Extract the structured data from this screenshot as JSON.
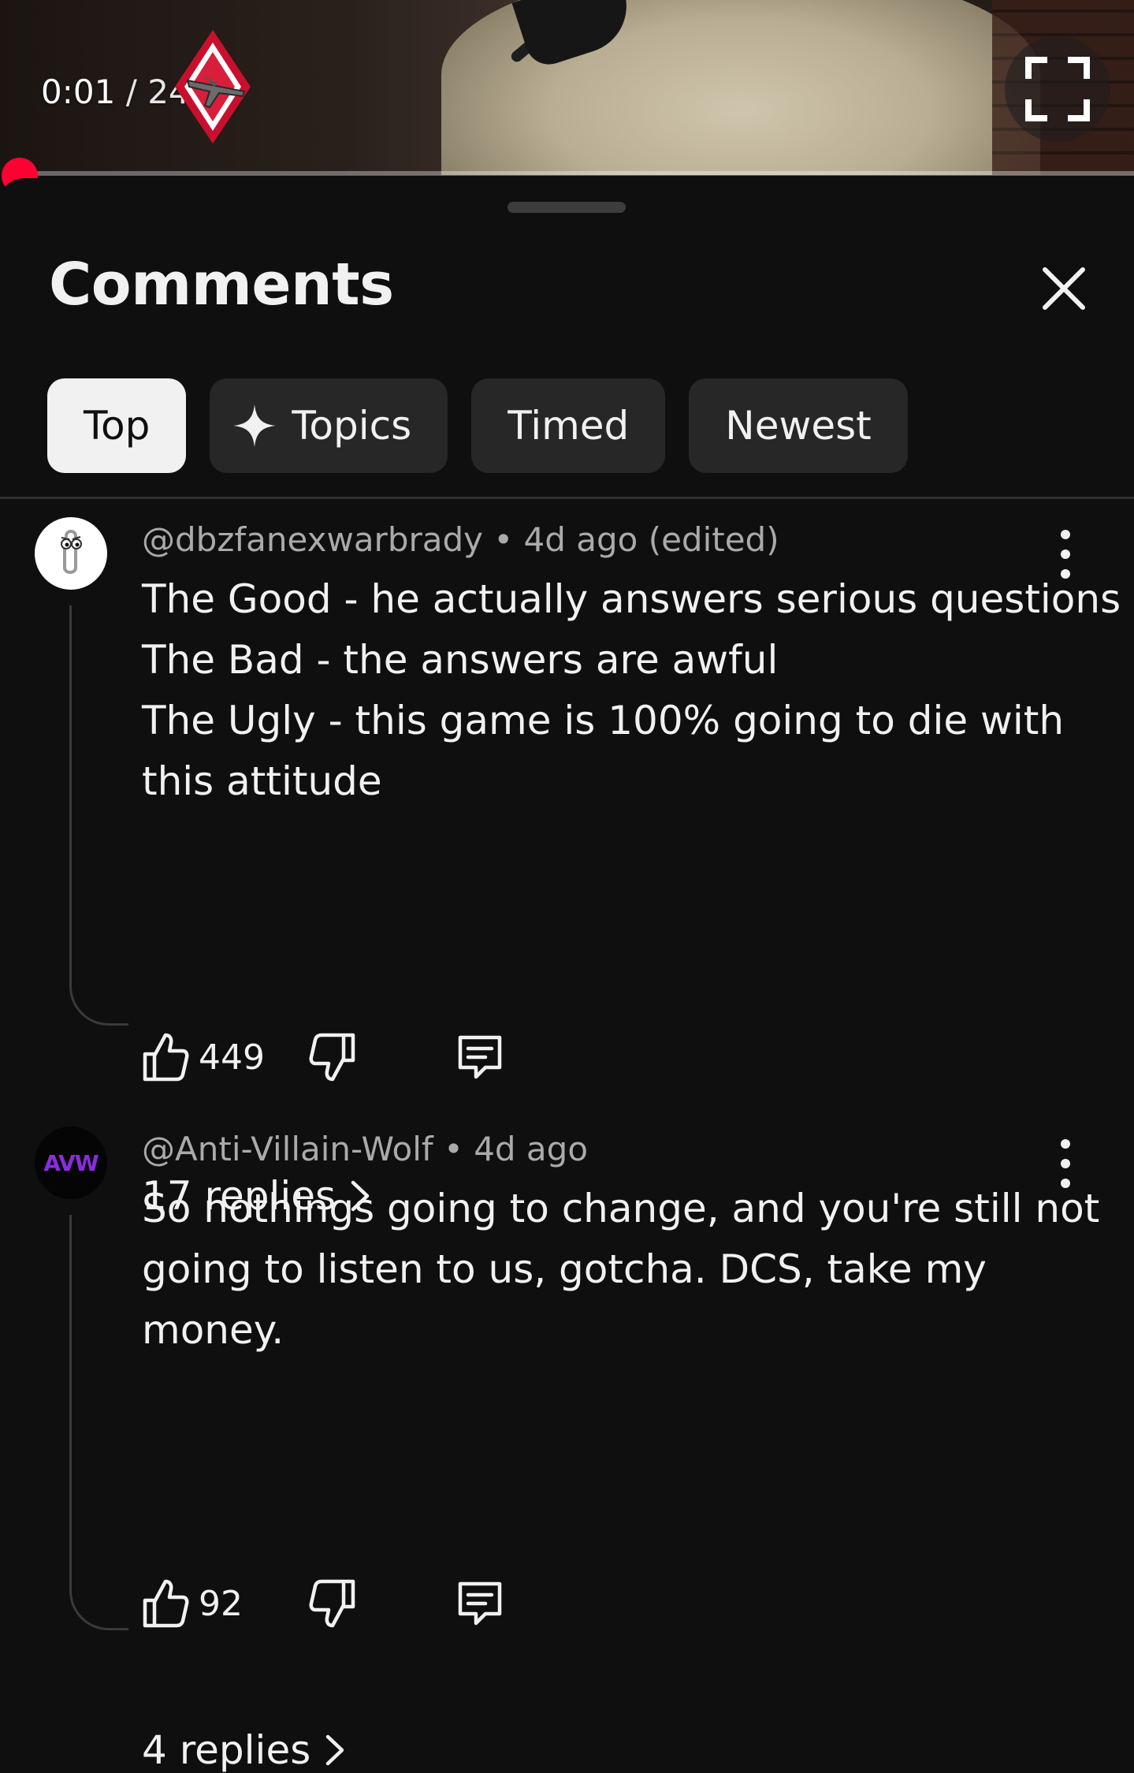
{
  "player": {
    "current_time": "0:01",
    "separator": "/",
    "duration": "24:46",
    "progress_fraction": 0.0007
  },
  "sheet": {
    "title": "Comments"
  },
  "filters": [
    {
      "label": "Top",
      "active": true
    },
    {
      "label": "Topics",
      "active": false,
      "icon": "sparkle-icon"
    },
    {
      "label": "Timed",
      "active": false
    },
    {
      "label": "Newest",
      "active": false
    }
  ],
  "comments": [
    {
      "author": "@dbzfanexwarbrady",
      "bullet": "•",
      "time": "4d ago (edited)",
      "avatar": "paperclip-avatar",
      "lines": [
        "The Good - he actually answers serious questions",
        "The Bad - the answers are awful",
        "The Ugly - this game is 100% going to die with",
        "this attitude"
      ],
      "likes": "449",
      "replies": "17 replies"
    },
    {
      "author": "@Anti-Villain-Wolf",
      "bullet": "•",
      "time": "4d ago",
      "avatar_text": "AVW",
      "lines": [
        "So nothings going to change, and you're still not",
        "going to listen to us, gotcha.  DCS, take my",
        "money."
      ],
      "likes": "92",
      "replies": "4 replies"
    }
  ],
  "colors": {
    "background": "#0f0f0f",
    "chip_bg": "#272727",
    "chip_active_bg": "#f1f1f1",
    "secondary_text": "#aaaaaa",
    "progress": "#ff0000",
    "avw_purple": "#8a2be2"
  }
}
